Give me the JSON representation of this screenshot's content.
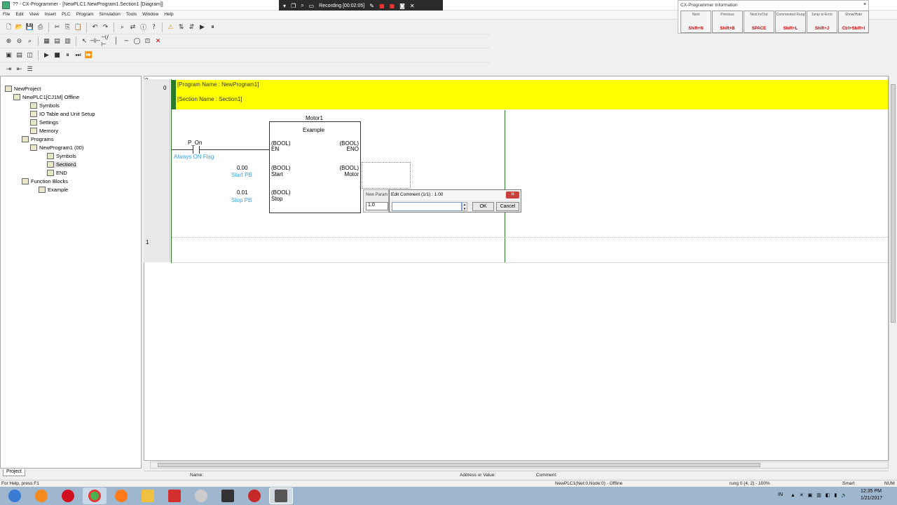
{
  "window": {
    "title": "?? - CX-Programmer - [NewPLC1.NewProgram1.Section1 [Diagram]]"
  },
  "menu": [
    "File",
    "Edit",
    "View",
    "Insert",
    "PLC",
    "Program",
    "Simulation",
    "Tools",
    "Window",
    "Help"
  ],
  "recording": {
    "label": "Recording [00:02:05]"
  },
  "info_panel": {
    "title": "CX-Programmer Information",
    "keys": [
      {
        "name": "Diff Up",
        "shortcut": "Shift+N",
        "caption": "Next"
      },
      {
        "name": "Diff Down",
        "shortcut": "Shift+B",
        "caption": "Previous"
      },
      {
        "name": "Diff None",
        "shortcut": "SPACE",
        "caption": "Next In/Out"
      },
      {
        "name": "Immediate Ref",
        "shortcut": "Shift+L",
        "caption": "Commented Rung"
      },
      {
        "name": "Information",
        "shortcut": "Shift+J",
        "caption": "Jump to Error"
      },
      {
        "name": "Show/Hide",
        "shortcut": "Ctrl+Shift+I",
        "caption": ""
      }
    ]
  },
  "tree": {
    "items": [
      {
        "label": "NewProject",
        "indent": 0
      },
      {
        "label": "NewPLC1[CJ1M] Offline",
        "indent": 1
      },
      {
        "label": "Symbols",
        "indent": 2
      },
      {
        "label": "IO Table and Unit Setup",
        "indent": 2
      },
      {
        "label": "Settings",
        "indent": 2
      },
      {
        "label": "Memory",
        "indent": 2
      },
      {
        "label": "Programs",
        "indent": 2
      },
      {
        "label": "NewProgram1 (00)",
        "indent": 3
      },
      {
        "label": "Symbols",
        "indent": 4
      },
      {
        "label": "Section1",
        "indent": 4
      },
      {
        "label": "END",
        "indent": 4
      },
      {
        "label": "Function Blocks",
        "indent": 2
      },
      {
        "label": "Example",
        "indent": 3
      }
    ],
    "tab": "Project"
  },
  "ladder": {
    "rung0": "0",
    "rung0_step": "0",
    "rung1": "1",
    "program_name": "[Program Name : NewProgram1]",
    "section_name": "[Section Name : Section1]",
    "contact_name": "P_On",
    "contact_comment": "Always ON Flag",
    "fb_instance": "Motor1",
    "fb_type": "Example",
    "inputs": [
      {
        "type": "(BOOL)",
        "name": "EN",
        "addr": "",
        "comment": ""
      },
      {
        "type": "(BOOL)",
        "name": "Start",
        "addr": "0.00",
        "comment": "Start PB"
      },
      {
        "type": "(BOOL)",
        "name": "Stop",
        "addr": "0.01",
        "comment": "Stop PB"
      }
    ],
    "outputs": [
      {
        "type": "(BOOL)",
        "name": "ENO"
      },
      {
        "type": "(BOOL)",
        "name": "Motor"
      }
    ]
  },
  "new_param": {
    "title": "New Param",
    "value": "1.0"
  },
  "dialog": {
    "title": "Edit Comment (1/1) : 1.00",
    "value": "",
    "ok": "OK",
    "cancel": "Cancel"
  },
  "status": {
    "name_label": "Name:",
    "address_label": "Address or Value:",
    "comment_label": "Comment:",
    "help": "For Help, press F1",
    "plc": "NewPLC1(Net:0,Node:0) - Offline",
    "position": "rung 0 (4, 2) - 100%",
    "mode": "Smart",
    "num": "NUM"
  },
  "taskbar": {
    "lang": "IN",
    "time": "12:35 PM",
    "date": "1/21/2017"
  }
}
